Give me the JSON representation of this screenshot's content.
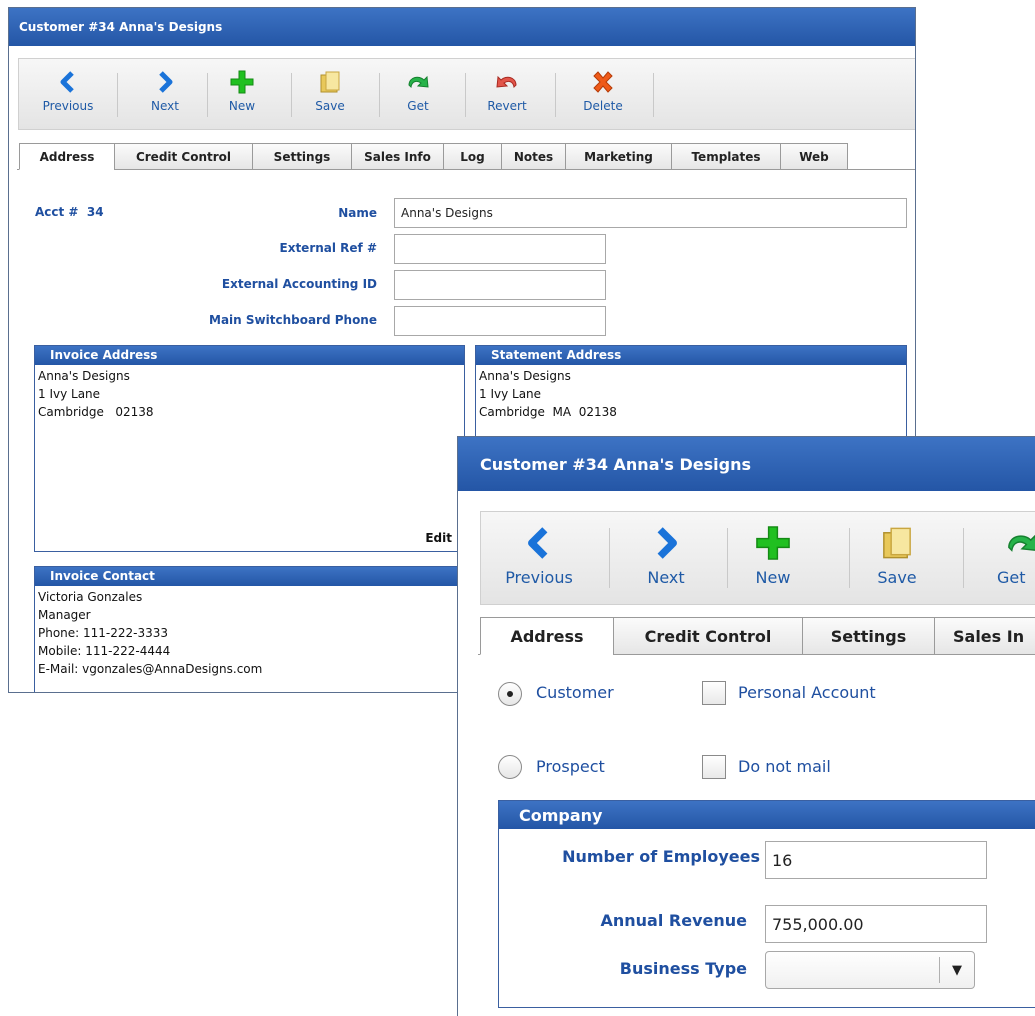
{
  "window": {
    "title": "Customer  #34  Anna's Designs"
  },
  "toolbar": {
    "previous": "Previous",
    "next": "Next",
    "new": "New",
    "save": "Save",
    "get": "Get",
    "revert": "Revert",
    "delete": "Delete"
  },
  "tabs": [
    "Address",
    "Credit Control",
    "Settings",
    "Sales Info",
    "Log",
    "Notes",
    "Marketing",
    "Templates",
    "Web"
  ],
  "front_tabs": [
    "Address",
    "Credit Control",
    "Settings",
    "Sales In"
  ],
  "front_toolbar": {
    "get": "Get"
  },
  "address": {
    "acct_label": "Acct #",
    "acct_value": "34",
    "name_label": "Name",
    "name_value": "Anna's Designs",
    "ext_ref_label": "External Ref #",
    "ext_ref_value": "",
    "ext_acc_label": "External Accounting ID",
    "ext_acc_value": "",
    "phone_label": "Main Switchboard Phone",
    "phone_value": ""
  },
  "invoice_address": {
    "title": "Invoice Address",
    "lines": [
      "Anna's Designs",
      "1 Ivy Lane",
      "Cambridge   02138"
    ],
    "edit": "Edit"
  },
  "statement_address": {
    "title": "Statement Address",
    "lines": [
      "Anna's Designs",
      "1 Ivy Lane",
      "Cambridge  MA  02138"
    ]
  },
  "invoice_contact": {
    "title": "Invoice Contact",
    "lines": [
      "Victoria Gonzales",
      "Manager",
      "Phone: 111-222-3333",
      "Mobile: 111-222-4444",
      "E-Mail: vgonzales@AnnaDesigns.com"
    ]
  },
  "options": {
    "customer": "Customer",
    "prospect": "Prospect",
    "personal_account": "Personal Account",
    "do_not_mail": "Do not mail"
  },
  "company": {
    "title": "Company",
    "employees_label": "Number of Employees",
    "employees_value": "16",
    "revenue_label": "Annual Revenue",
    "revenue_value": "755,000.00",
    "business_type_label": "Business Type",
    "business_type_value": ""
  },
  "colors": {
    "accent": "#2456a6",
    "label": "#1f4fa0"
  }
}
